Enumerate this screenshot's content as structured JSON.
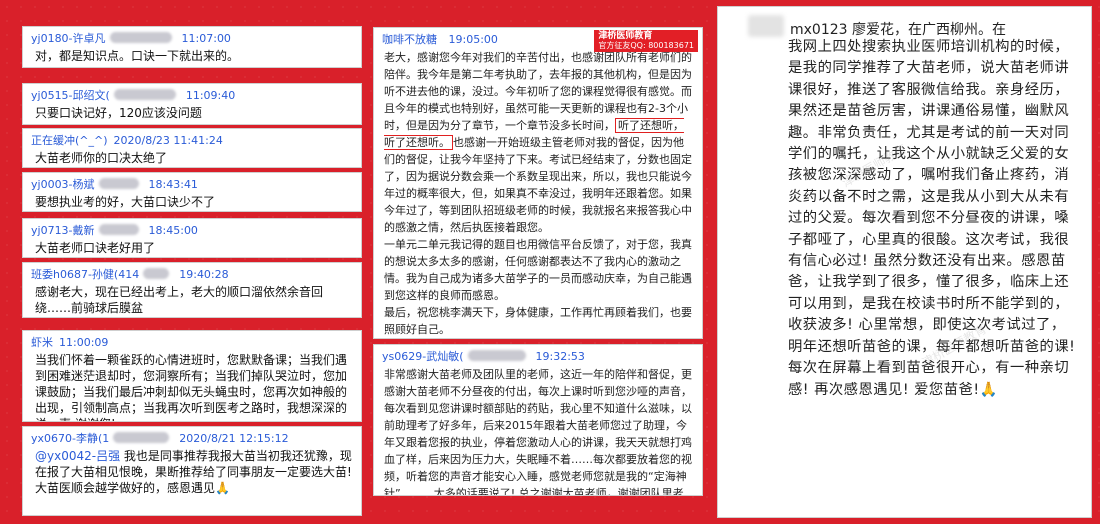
{
  "left_messages": [
    {
      "user": "yj0180-许卓凡",
      "time": "11:07:00",
      "text": "对，都是知识点。口诀一下就出来的。"
    },
    {
      "user": "yj0515-邱绍文(",
      "time": "11:09:40",
      "text": "只要口诀记好，120应该没问题"
    },
    {
      "user": "正在缓冲(^_^)",
      "time": "2020/8/23 11:41:24",
      "text": "大苗老师你的口决太绝了"
    },
    {
      "user": "yj0003-杨斌",
      "time": "18:43:41",
      "text": "要想执业考的好，大苗口诀少不了"
    },
    {
      "user": "yj0713-戴新",
      "time": "18:45:00",
      "text": "大苗老师口诀老好用了"
    },
    {
      "user": "班委h0687-孙健(414",
      "time": "19:40:28",
      "text": "感谢老大，现在已经出考上，老大的顺口溜依然余音回绕……前骑球后膜盆"
    },
    {
      "user": "虾米",
      "time": "11:00:09",
      "text": "当我们怀着一颗雀跃的心情进班时，您默默备课；当我们遇到困难迷茫退却时，您洞察所有；当我们掉队哭泣时，您加课鼓励；当我们最后冲刺却似无头蝇虫时，您再次如神般的出现，引领制高点；当我再次听到医考之路时，我想深深的说一声 谢谢您!"
    },
    {
      "user": "yx0670-李静(1",
      "time": "2020/8/21 12:15:12",
      "mention": "@yx0042-吕强",
      "text": "我也是同事推荐我报大苗当初我还犹豫，现在报了大苗相见恨晚，果断推荐给了同事朋友一定要选大苗! 大苗医顺会越学做好的，感恩遇见🙏"
    }
  ],
  "middle_top": {
    "user": "咖啡不放糖",
    "time": "19:05:00",
    "badge_title": "津桥医师教育",
    "badge_sub": "官方征友QQ: 800183671",
    "p1_before": "老大，感谢您今年对我们的辛苦付出，也感谢团队所有老师们的陪伴。我今年是第二年考执助了，去年报的其他机构，但是因为听不进去他的课，没过。今年初听了您的课程觉得很有感觉。而且今年的模式也特别好，虽然可能一天更新的课程也有2-3个小时，但是因为分了章节，一个章节没多长时间，",
    "p1_highlight": "听了还想听，听了还想听。",
    "p1_after": "也感谢一开始班级主管老师对我的督促，因为他们的督促，让我今年坚持了下来。考试已经结束了，分数也固定了，因为据说分数会乘一个系数呈现出来，所以，我也只能说今年过的概率很大，但，如果真不幸没过，我明年还跟着您。如果今年过了，等到团队招班级老师的时候，我就报名来报答我心中的感激之情，然后执医接着跟您。",
    "p2": "一单元二单元我记得的题目也用微信平台反馈了，对于您，我真的想说太多太多的感谢，任何感谢都表达不了我内心的激动之情。我为自己成为诸多大苗学子的一员而感动庆幸，为自己能遇到您这样的良师而感恩。",
    "p3": "最后，祝您桃李满天下，身体健康，工作再忙再顾着我们，也要照顾好自己。"
  },
  "middle_bottom": {
    "user": "ys0629-武灿敏(",
    "time": "19:32:53",
    "text": "非常感谢大苗老师及团队里的老师，这近一年的陪伴和督促，更感谢大苗老师不分昼夜的付出，每次上课时听到您沙哑的声音，每次看到见您讲课时额部贴的药贴，我心里不知道什么滋味，以前助理考了好多年，后来2015年跟着大苗老师您过了助理，今年又跟着您报的执业，停着您激动人心的讲课，我天天就想打鸡血了样，后来因为压力大，失眠睡不着……每次都要放着您的视频，听着您的声音才能安心入睡，感觉老师您就是我的“定海神针”………太多的话要说了! 总之谢谢大苗老师，谢谢团队里老师!"
  },
  "right_panel": {
    "head": "mx0123 廖爱花，在广西柳州。在",
    "body": "我网上四处搜索执业医师培训机构的时候，是我的同学推荐了大苗老师，说大苗老师讲课很好，推送了客服微信给我。亲身经历，果然还是苗爸厉害，讲课通俗易懂，幽默风趣。非常负责任，尤其是考试的前一天对同学们的嘱托，让我这个从小就缺乏父爱的女孩被您深深感动了，嘱咐我们备止疼药，消炎药以备不时之需，这是我从小到大从未有过的父爱。每次看到您不分昼夜的讲课，嗓子都哑了，心里真的很酸。这次考试，我很有信心必过! 虽然分数还没有出来。感恩苗爸，让我学到了很多，懂了很多，临床上还可以用到，是我在校读书时所不能学到的，收获波多! 心里常想，即使这次考试过了，明年还想听苗爸的课，每年都想听苗爸的课! 每次在屏幕上看到苗爸很开心，有一种亲切感! 再次感恩遇见! 爱您苗爸!🙏"
  },
  "watermark": "津桥医师教育"
}
